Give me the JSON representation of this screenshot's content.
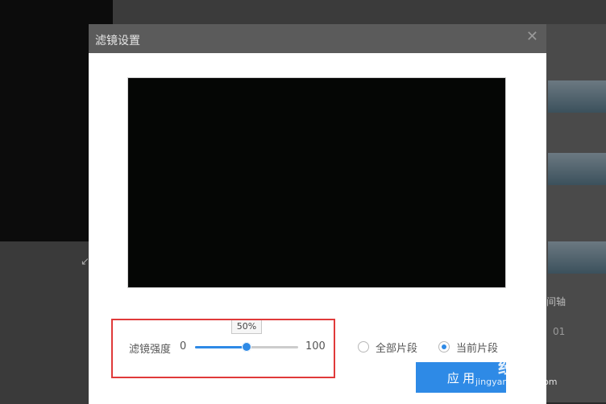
{
  "dialog": {
    "title": "滤镜设置",
    "close_icon": "close-icon"
  },
  "strength": {
    "label": "滤镜强度",
    "min": "0",
    "max": "100",
    "value_label": "50%",
    "value": 0.5
  },
  "scope": {
    "all_label": "全部片段",
    "current_label": "当前片段",
    "selected": "current"
  },
  "apply_label": "应 用",
  "background": {
    "right_text": "间轴",
    "right_time": "01"
  },
  "watermark": {
    "brand": "经验",
    "url": "jingyan.baidu.com"
  },
  "colors": {
    "accent": "#2e8ae6",
    "highlight": "#e03a3a",
    "preview": "#050605"
  }
}
